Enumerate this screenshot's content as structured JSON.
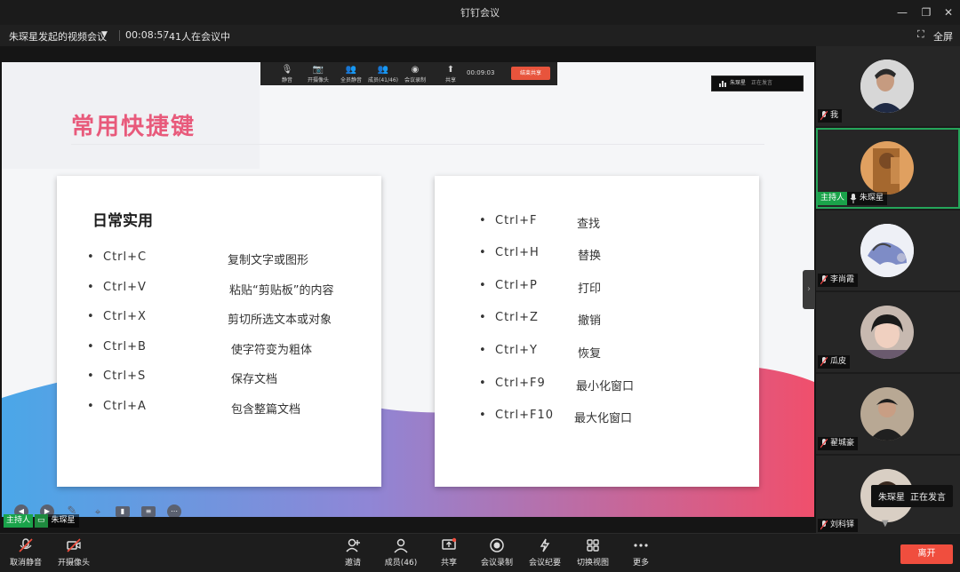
{
  "window": {
    "title": "钉钉会议"
  },
  "infobar": {
    "meeting_name": "朱琛星发起的视频会议",
    "duration": "00:08:57",
    "attendance": "41人在会议中",
    "fullscreen_label": "全屏"
  },
  "presenter_bar": {
    "mute": "静音",
    "camera": "开摄像头",
    "mute_all": "全员静音",
    "members": "成员(41/46)",
    "record": "会议录制",
    "share": "共享",
    "timer": "00:09:03",
    "stop_share": "结束共享"
  },
  "speaking_chip": {
    "name": "朱琛星",
    "status": "正在发言"
  },
  "slide": {
    "title": "常用快捷键",
    "left_card": {
      "heading": "日常实用",
      "rows": [
        {
          "key": "Ctrl+C",
          "desc": "复制文字或图形"
        },
        {
          "key": "Ctrl+V",
          "desc": "粘贴“剪贴板”的内容"
        },
        {
          "key": "Ctrl+X",
          "desc": "剪切所选文本或对象"
        },
        {
          "key": "Ctrl+B",
          "desc": "使字符变为粗体"
        },
        {
          "key": "Ctrl+S",
          "desc": "保存文档"
        },
        {
          "key": "Ctrl+A",
          "desc": "包含整篇文档"
        }
      ]
    },
    "right_card": {
      "rows": [
        {
          "key": "Ctrl+F",
          "desc": "查找"
        },
        {
          "key": "Ctrl+H",
          "desc": "替换"
        },
        {
          "key": "Ctrl+P",
          "desc": "打印"
        },
        {
          "key": "Ctrl+Z",
          "desc": "撤销"
        },
        {
          "key": "Ctrl+Y",
          "desc": "恢复"
        },
        {
          "key": "Ctrl+F9",
          "desc": "最小化窗口"
        },
        {
          "key": "Ctrl+F10",
          "desc": "最大化窗口"
        }
      ]
    },
    "bullet": "•"
  },
  "host_tag": {
    "badge": "主持人",
    "name": "朱琛星"
  },
  "participants": [
    {
      "name": "我",
      "host": false
    },
    {
      "name": "朱琛星",
      "host": true,
      "badge": "主持人"
    },
    {
      "name": "李尚霞",
      "host": false
    },
    {
      "name": "瓜皮",
      "host": false
    },
    {
      "name": "翟城豪",
      "host": false
    },
    {
      "name": "刘科铎",
      "host": false
    }
  ],
  "tooltip": {
    "name": "朱琛星",
    "status": "正在发言"
  },
  "toolbar": {
    "unmute": "取消静音",
    "camera": "开摄像头",
    "invite": "邀请",
    "members": "成员(46)",
    "share": "共享",
    "record": "会议录制",
    "minutes": "会议纪要",
    "switch_view": "切换视图",
    "more": "更多",
    "leave": "离开"
  },
  "colors": {
    "title_pink": "#e85a7b",
    "leave_red": "#f04e3e",
    "host_green": "#1aa34a"
  }
}
